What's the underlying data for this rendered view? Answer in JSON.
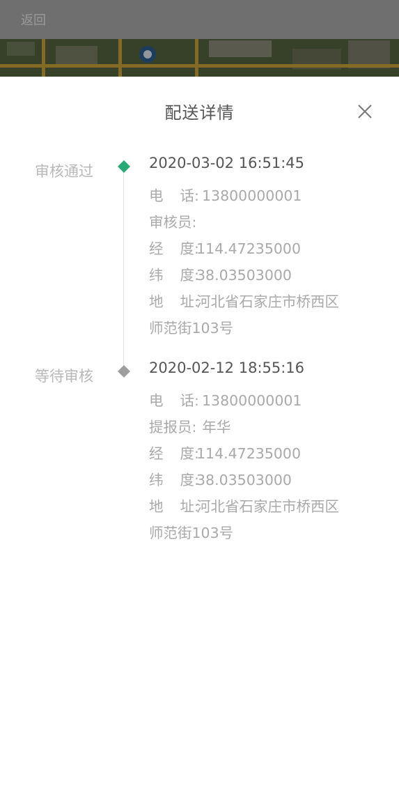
{
  "header": {
    "back_label": "返回"
  },
  "sheet": {
    "title": "配送详情"
  },
  "events": [
    {
      "status": "审核通过",
      "marker_color": "#2aa876",
      "time": "2020-03-02 16:51:45",
      "phone_label_1": "电",
      "phone_label_2": "话:",
      "phone": "13800000001",
      "role_label": "审核员:",
      "role_name": "",
      "lng_label_1": "经",
      "lng_label_2": "度:",
      "lng": "114.47235000",
      "lat_label_1": "纬",
      "lat_label_2": "度:",
      "lat": "38.03503000",
      "addr_label_1": "地",
      "addr_label_2": "址:",
      "addr_line1": "河北省石家庄市桥西区",
      "addr_line2": "师范街103号"
    },
    {
      "status": "等待审核",
      "marker_color": "#9e9e9e",
      "time": "2020-02-12 18:55:16",
      "phone_label_1": "电",
      "phone_label_2": "话:",
      "phone": "13800000001",
      "role_label": "提报员:",
      "role_name": "年华",
      "lng_label_1": "经",
      "lng_label_2": "度:",
      "lng": "114.47235000",
      "lat_label_1": "纬",
      "lat_label_2": "度:",
      "lat": "38.03503000",
      "addr_label_1": "地",
      "addr_label_2": "址:",
      "addr_line1": "河北省石家庄市桥西区",
      "addr_line2": "师范街103号"
    }
  ]
}
